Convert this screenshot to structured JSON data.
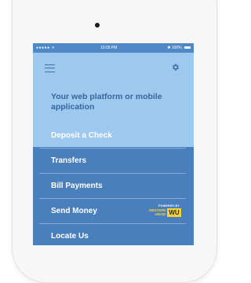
{
  "statusbar": {
    "signal": "●●●●● ᯤ",
    "time": "10:05 PM",
    "battery": "✱ 100%"
  },
  "header": {
    "tagline": "Your web platform or mobile application",
    "menu_icon": "hamburger-icon",
    "settings_icon": "gear-icon"
  },
  "menu": {
    "items": [
      {
        "label": "Deposit a Check"
      },
      {
        "label": "Transfers"
      },
      {
        "label": "Bill Payments"
      },
      {
        "label": "Send Money"
      },
      {
        "label": "Locate Us"
      }
    ],
    "partner": {
      "powered_by": "POWERED BY",
      "brand_line1": "WESTERN",
      "brand_line2": "UNION",
      "brand_mark": "WU"
    }
  },
  "colors": {
    "header_bg": "#9dc9ef",
    "menu_bg": "#4a7fbd",
    "tagline": "#34669f",
    "brand_yellow": "#f6d23a"
  }
}
